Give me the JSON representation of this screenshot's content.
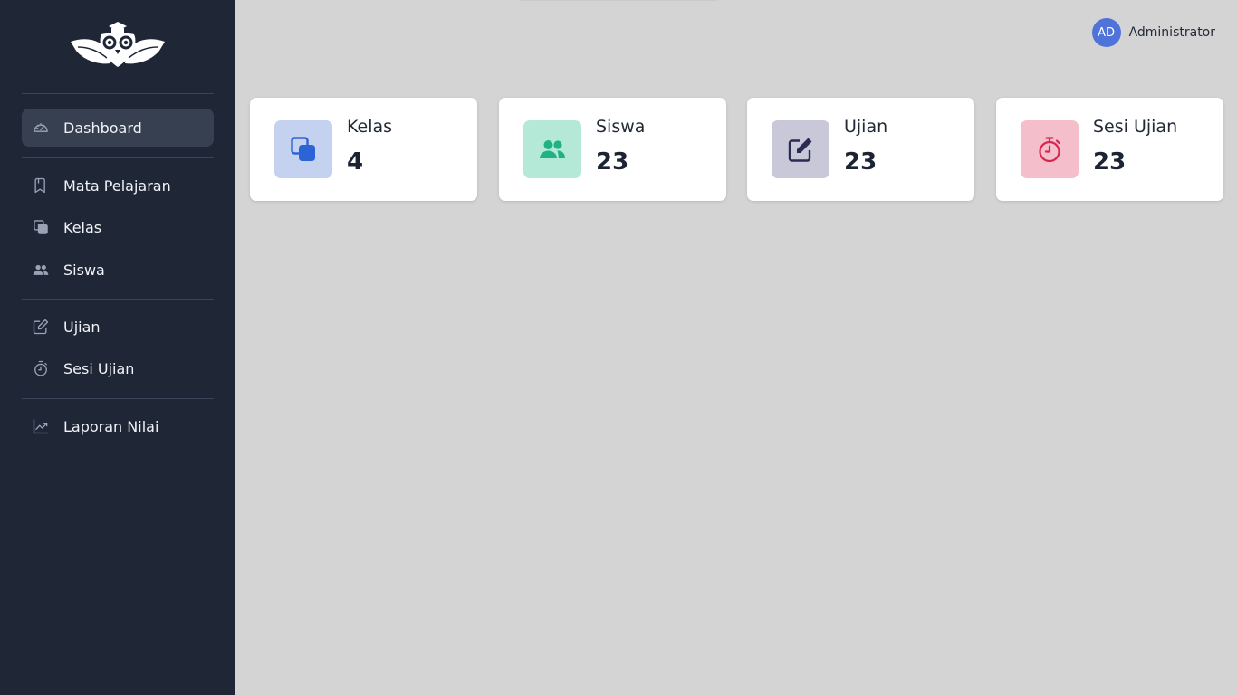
{
  "sidebar": {
    "items": [
      {
        "label": "Dashboard",
        "icon": "gauge-icon",
        "active": true
      },
      {
        "label": "Mata Pelajaran",
        "icon": "bookmark-icon"
      },
      {
        "label": "Kelas",
        "icon": "copy-icon"
      },
      {
        "label": "Siswa",
        "icon": "users-icon"
      },
      {
        "label": "Ujian",
        "icon": "edit-icon"
      },
      {
        "label": "Sesi Ujian",
        "icon": "stopwatch-icon"
      },
      {
        "label": "Laporan Nilai",
        "icon": "chart-line-icon"
      }
    ]
  },
  "header": {
    "user": {
      "initials": "AD",
      "name": "Administrator"
    }
  },
  "cards": [
    {
      "title": "Kelas",
      "value": "4",
      "icon": "copy-icon",
      "icon_bg": "#c4d2ef",
      "icon_color": "#2c64d6"
    },
    {
      "title": "Siswa",
      "value": "23",
      "icon": "users-icon",
      "icon_bg": "#b5e9d7",
      "icon_color": "#1fb283"
    },
    {
      "title": "Ujian",
      "value": "23",
      "icon": "edit-icon",
      "icon_bg": "#c9c8d9",
      "icon_color": "#2a2a52"
    },
    {
      "title": "Sesi Ujian",
      "value": "23",
      "icon": "stopwatch-icon",
      "icon_bg": "#f4bfcb",
      "icon_color": "#d6284e"
    }
  ],
  "colors": {
    "sidebar_bg": "#1f2737",
    "page_bg": "#d4d4d4",
    "accent": "#4f73d9"
  }
}
